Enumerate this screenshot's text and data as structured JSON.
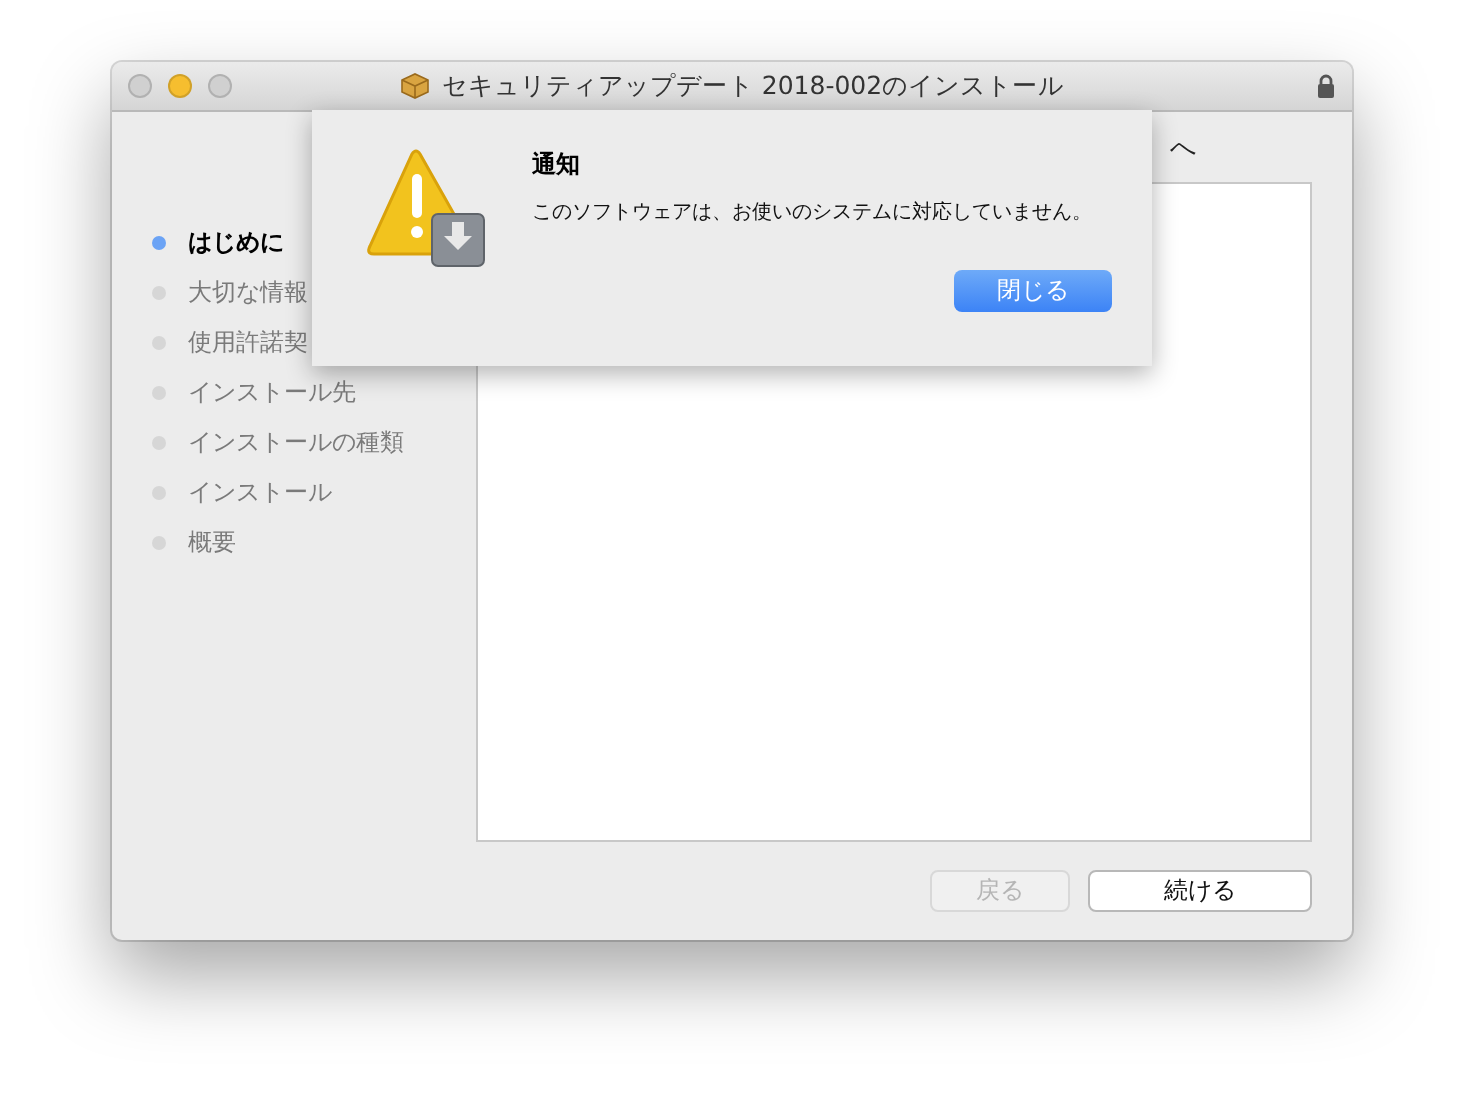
{
  "window": {
    "title": "セキュリティアップデート 2018-002のインストール"
  },
  "heading": "へ",
  "steps": [
    {
      "label": "はじめに",
      "selected": true
    },
    {
      "label": "大切な情報",
      "selected": false
    },
    {
      "label": "使用許諾契",
      "selected": false
    },
    {
      "label": "インストール先",
      "selected": false
    },
    {
      "label": "インストールの種類",
      "selected": false
    },
    {
      "label": "インストール",
      "selected": false
    },
    {
      "label": "概要",
      "selected": false
    }
  ],
  "buttons": [
    {
      "label": "戻る",
      "disabled": true
    },
    {
      "label": "続ける",
      "disabled": false
    }
  ],
  "alert": {
    "title": "通知",
    "message": "このソフトウェアは、お使いのシステムに対応していません。",
    "button": "閉じる"
  }
}
